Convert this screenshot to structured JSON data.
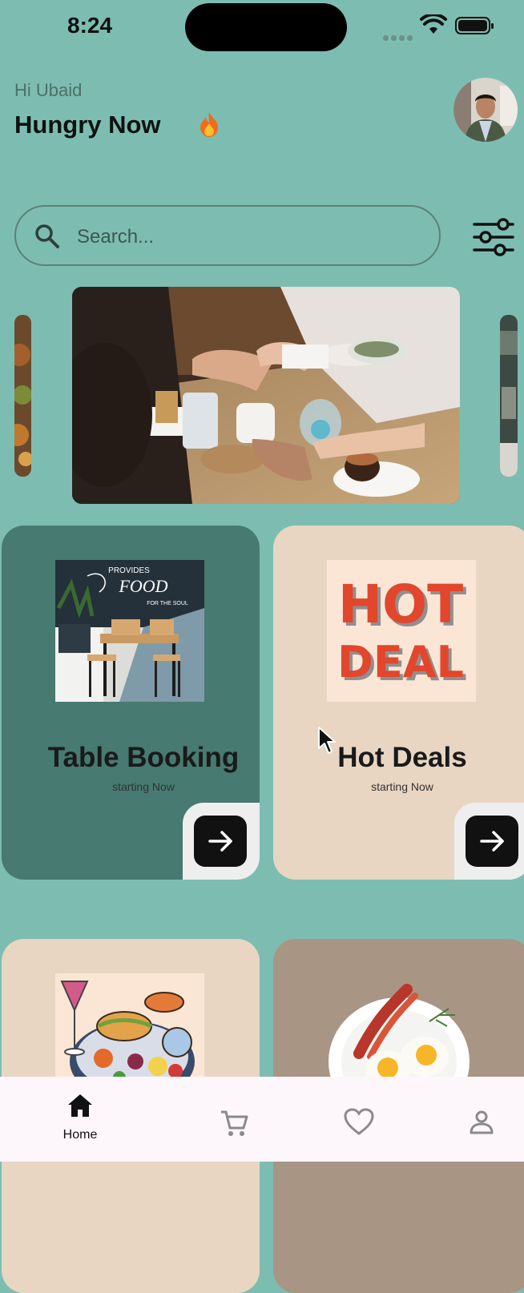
{
  "status": {
    "time": "8:24"
  },
  "header": {
    "greeting": "Hi Ubaid",
    "headline": "Hungry Now",
    "headline_emoji": "fire-icon"
  },
  "search": {
    "placeholder": "Search..."
  },
  "cards": [
    {
      "title": "Table Booking",
      "subtitle": "starting Now"
    },
    {
      "title": "Hot Deals",
      "subtitle": "starting Now"
    }
  ],
  "hot_deal_art": {
    "line1": "HOT",
    "line2": "DEAL"
  },
  "chalkboard_art": {
    "line1": "PROVIDES",
    "line2": "FOOD",
    "line3": "FOR THE SOUL"
  },
  "bottom_nav": [
    {
      "label": "Home",
      "icon": "home-icon",
      "active": true
    },
    {
      "label": "",
      "icon": "cart-icon",
      "active": false
    },
    {
      "label": "",
      "icon": "heart-icon",
      "active": false
    },
    {
      "label": "",
      "icon": "profile-icon",
      "active": false
    }
  ],
  "colors": {
    "background": "#7dbdb1",
    "card_green": "#477a70",
    "card_beige": "#e8d6c2",
    "nav_bg": "#fdf6fb"
  }
}
